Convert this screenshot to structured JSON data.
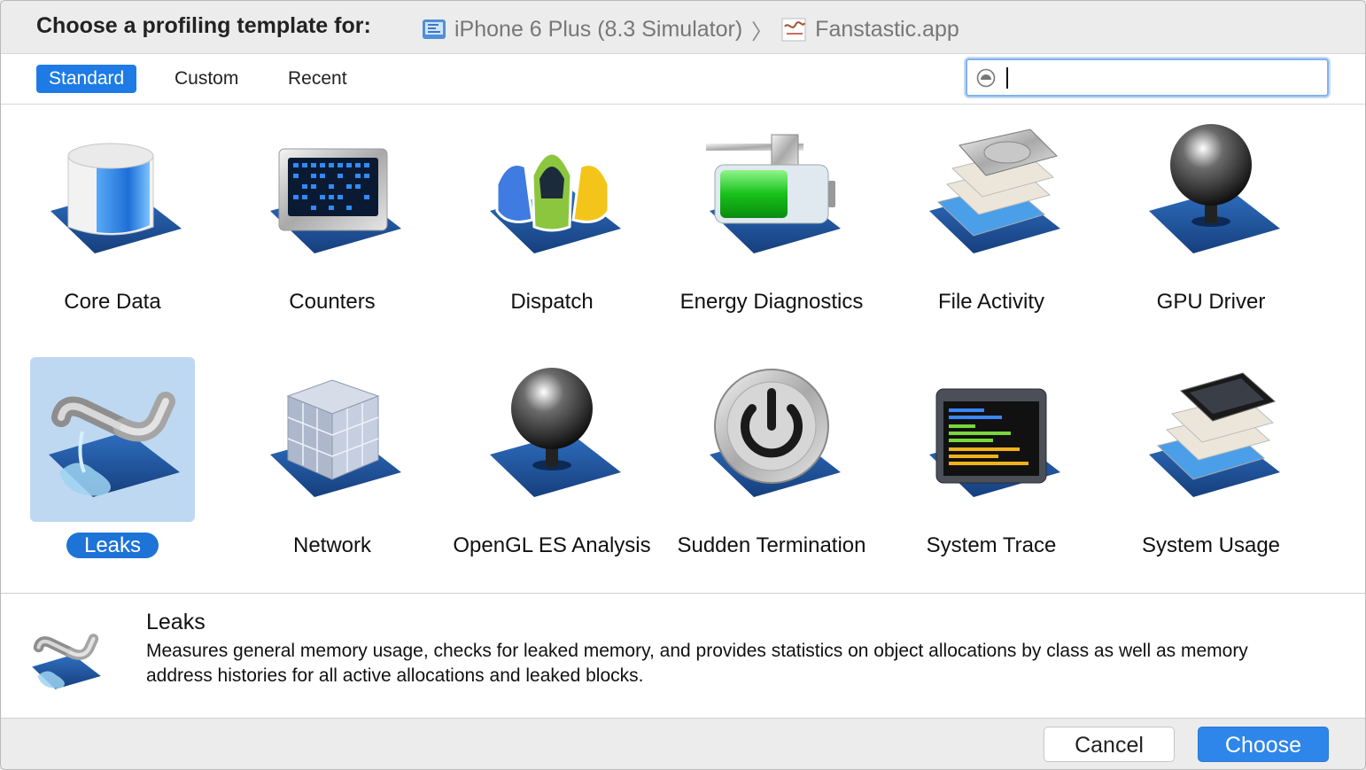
{
  "header": {
    "title": "Choose a profiling template for:",
    "device_icon": "simulator-icon",
    "device": "iPhone 6 Plus (8.3 Simulator)",
    "separator": "〉",
    "app_icon": "app-icon",
    "app": "Fanstastic.app"
  },
  "tabs": [
    {
      "label": "Standard",
      "active": true
    },
    {
      "label": "Custom",
      "active": false
    },
    {
      "label": "Recent",
      "active": false
    }
  ],
  "search": {
    "placeholder": "",
    "value": "",
    "icon": "search-filter-icon"
  },
  "templates": [
    {
      "label": "Core Data",
      "icon": "core-data-icon"
    },
    {
      "label": "Counters",
      "icon": "counters-icon"
    },
    {
      "label": "Dispatch",
      "icon": "dispatch-icon"
    },
    {
      "label": "Energy Diagnostics",
      "icon": "energy-diagnostics-icon"
    },
    {
      "label": "File Activity",
      "icon": "file-activity-icon"
    },
    {
      "label": "GPU Driver",
      "icon": "gpu-driver-icon"
    },
    {
      "label": "Leaks",
      "icon": "leaks-icon",
      "selected": true
    },
    {
      "label": "Network",
      "icon": "network-icon"
    },
    {
      "label": "OpenGL ES Analysis",
      "icon": "opengl-es-analysis-icon"
    },
    {
      "label": "Sudden Termination",
      "icon": "sudden-termination-icon"
    },
    {
      "label": "System Trace",
      "icon": "system-trace-icon"
    },
    {
      "label": "System Usage",
      "icon": "system-usage-icon"
    }
  ],
  "description": {
    "icon": "leaks-icon",
    "title": "Leaks",
    "text": "Measures general memory usage, checks for leaked memory, and provides statistics on object allocations by class as well as memory address histories for all active allocations and leaked blocks."
  },
  "buttons": {
    "cancel": "Cancel",
    "choose": "Choose"
  },
  "colors": {
    "accent": "#1e7be6",
    "selection": "#bfd8f1",
    "blueprint": "#1f5aa8"
  }
}
